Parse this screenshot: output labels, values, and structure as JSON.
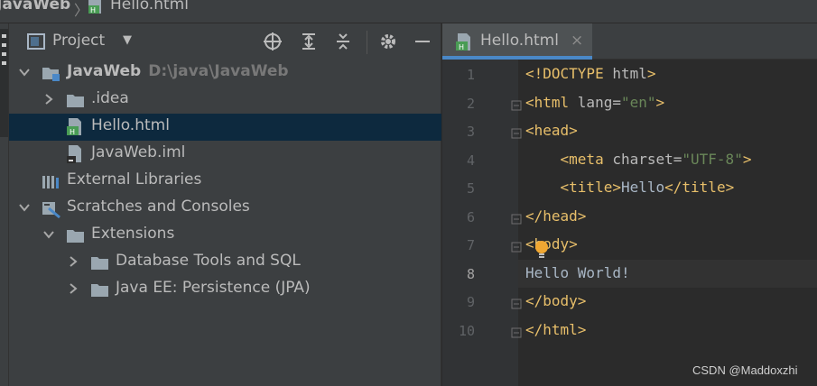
{
  "breadcrumb": {
    "project": "JavaWeb",
    "separator": "〉",
    "file": "Hello.html"
  },
  "project_panel": {
    "title": "Project",
    "icons": [
      "target-icon",
      "expand-all-icon",
      "collapse-all-icon",
      "gear-icon",
      "minimize-icon"
    ],
    "tree": [
      {
        "label": "JavaWeb",
        "path": "D:\\java\\JavaWeb",
        "icon": "module-folder-icon",
        "expanded": true
      },
      {
        "label": ".idea",
        "icon": "folder-icon",
        "expanded": false
      },
      {
        "label": "Hello.html",
        "icon": "html-file-icon",
        "selected": true
      },
      {
        "label": "JavaWeb.iml",
        "icon": "iml-file-icon"
      },
      {
        "label": "External Libraries",
        "icon": "libraries-icon"
      },
      {
        "label": "Scratches and Consoles",
        "icon": "scratches-icon",
        "expanded": true
      },
      {
        "label": "Extensions",
        "icon": "folder-icon",
        "expanded": true
      },
      {
        "label": "Database Tools and SQL",
        "icon": "folder-icon",
        "expanded": false
      },
      {
        "label": "Java EE: Persistence (JPA)",
        "icon": "folder-icon",
        "expanded": false
      }
    ]
  },
  "editor": {
    "tab": {
      "label": "Hello.html",
      "close": "×"
    },
    "line_numbers": [
      "1",
      "2",
      "3",
      "4",
      "5",
      "6",
      "7",
      "8",
      "9",
      "10"
    ],
    "current_line": 8,
    "lines": [
      {
        "parts": [
          {
            "t": "tag",
            "v": "<!DOCTYPE "
          },
          {
            "t": "attr",
            "v": "html"
          },
          {
            "t": "tag",
            "v": ">"
          }
        ]
      },
      {
        "parts": [
          {
            "t": "tag",
            "v": "<html "
          },
          {
            "t": "attr",
            "v": "lang="
          },
          {
            "t": "val",
            "v": "\"en\""
          },
          {
            "t": "tag",
            "v": ">"
          }
        ]
      },
      {
        "parts": [
          {
            "t": "tag",
            "v": "<head>"
          }
        ]
      },
      {
        "parts": [
          {
            "t": "text",
            "v": "    "
          },
          {
            "t": "tag",
            "v": "<meta "
          },
          {
            "t": "attr",
            "v": "charset="
          },
          {
            "t": "val",
            "v": "\"UTF-8\""
          },
          {
            "t": "tag",
            "v": ">"
          }
        ]
      },
      {
        "parts": [
          {
            "t": "text",
            "v": "    "
          },
          {
            "t": "tag",
            "v": "<title>"
          },
          {
            "t": "text",
            "v": "Hello"
          },
          {
            "t": "tag",
            "v": "</title>"
          }
        ]
      },
      {
        "parts": [
          {
            "t": "tag",
            "v": "</head>"
          }
        ]
      },
      {
        "parts": [
          {
            "t": "tag",
            "v": "<body>"
          }
        ]
      },
      {
        "parts": [
          {
            "t": "text",
            "v": "Hello World!"
          }
        ]
      },
      {
        "parts": [
          {
            "t": "tag",
            "v": "</body>"
          }
        ]
      },
      {
        "parts": [
          {
            "t": "tag",
            "v": "</html>"
          }
        ]
      }
    ]
  },
  "watermark": "CSDN @Maddoxzhi",
  "colors": {
    "background": "#2b2b2b",
    "panel": "#3c3f41",
    "selection": "#0d293e",
    "tag": "#e8bf6a",
    "string": "#6a8759",
    "text": "#a9b7c6",
    "accent": "#4a88c7"
  }
}
